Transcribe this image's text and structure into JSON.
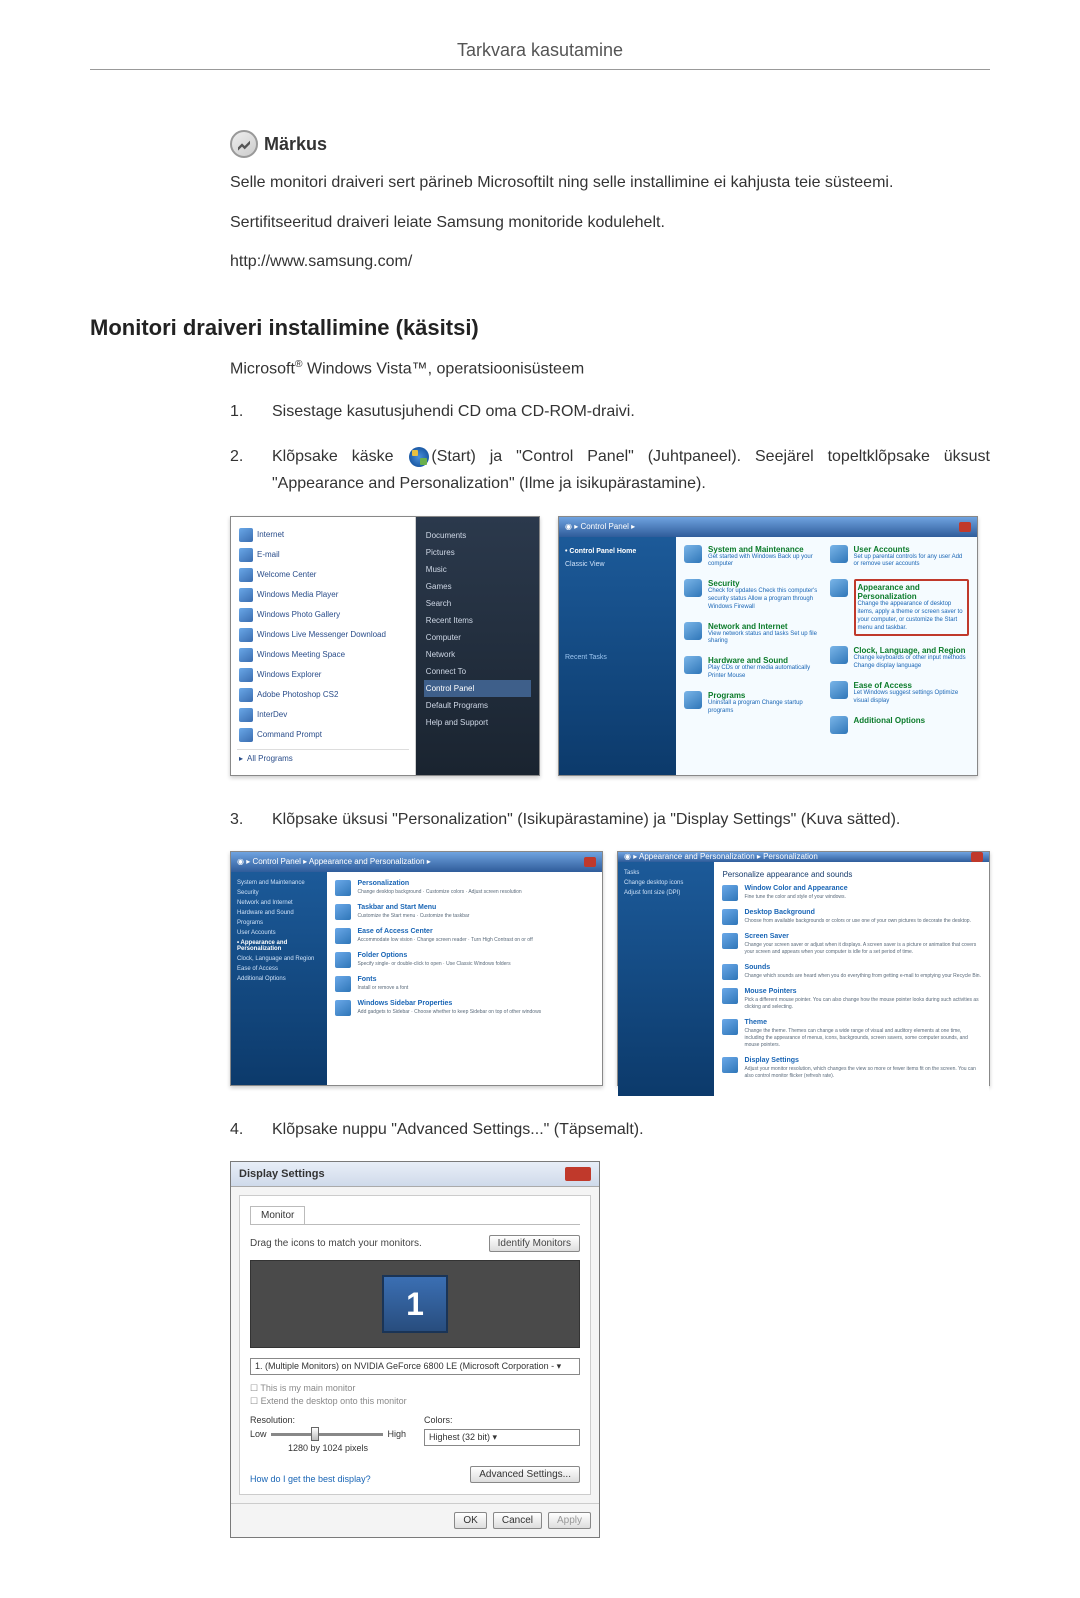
{
  "header": {
    "title": "Tarkvara kasutamine"
  },
  "note": {
    "label": "Märkus",
    "p1": "Selle monitori draiveri sert pärineb Microsoftilt ning selle installimine ei kahjusta teie süsteemi.",
    "p2": "Sertifitseeritud draiveri leiate Samsung monitoride kodulehelt.",
    "p3": "http://www.samsung.com/"
  },
  "section": {
    "title": "Monitori draiveri installimine (käsitsi)",
    "intro_prefix": "Microsoft",
    "intro_mid": " Windows Vista™",
    "intro_suffix": ", operatsioonisüsteem"
  },
  "steps": {
    "s1": {
      "num": "1.",
      "text": "Sisestage kasutusjuhendi CD oma CD-ROM-draivi."
    },
    "s2": {
      "num": "2.",
      "pre": "Klõpsake käske ",
      "post": "(Start) ja \"Control Panel\" (Juhtpaneel). Seejärel topeltklõpsake üksust \"Appearance and Personalization\" (Ilme ja isikupärastamine)."
    },
    "s3": {
      "num": "3.",
      "text": "Klõpsake üksusi \"Personalization\" (Isikupärastamine) ja \"Display Settings\" (Kuva sätted)."
    },
    "s4": {
      "num": "4.",
      "text": "Klõpsake nuppu \"Advanced Settings...\" (Täpsemalt)."
    }
  },
  "vista_start": {
    "items": [
      "Internet",
      "E-mail",
      "Welcome Center",
      "Windows Media Player",
      "Windows Photo Gallery",
      "Windows Live Messenger Download",
      "Windows Meeting Space",
      "Windows Explorer",
      "Adobe Photoshop CS2",
      "InterDev",
      "Command Prompt",
      "All Programs"
    ],
    "right": [
      "Documents",
      "Pictures",
      "Music",
      "Games",
      "Search",
      "Recent Items",
      "Computer",
      "Network",
      "Connect To",
      "Control Panel",
      "Default Programs",
      "Help and Support"
    ]
  },
  "control_panel": {
    "title": "Control Panel",
    "side": [
      "Control Panel Home",
      "Classic View"
    ],
    "recent": "Recent Tasks",
    "cats": {
      "system": {
        "t": "System and Maintenance",
        "s": "Get started with Windows\nBack up your computer"
      },
      "security": {
        "t": "Security",
        "s": "Check for updates\nCheck this computer's security status\nAllow a program through Windows Firewall"
      },
      "network": {
        "t": "Network and Internet",
        "s": "View network status and tasks\nSet up file sharing"
      },
      "hardware": {
        "t": "Hardware and Sound",
        "s": "Play CDs or other media automatically\nPrinter\nMouse"
      },
      "programs": {
        "t": "Programs",
        "s": "Uninstall a program\nChange startup programs"
      },
      "user": {
        "t": "User Accounts",
        "s": "Set up parental controls for any user\nAdd or remove user accounts"
      },
      "appearance": {
        "t": "Appearance and Personalization",
        "s": "Change the appearance of desktop items, apply a theme or screen saver to your computer, or customize the Start menu and taskbar."
      },
      "clock": {
        "t": "Clock, Language, and Region",
        "s": "Change keyboards or other input methods\nChange display language"
      },
      "ease": {
        "t": "Ease of Access",
        "s": "Let Windows suggest settings\nOptimize visual display"
      },
      "addl": {
        "t": "Additional Options"
      }
    }
  },
  "appearance_left": {
    "side": [
      "System and Maintenance",
      "Security",
      "Network and Internet",
      "Hardware and Sound",
      "Programs",
      "User Accounts",
      "Appearance and Personalization",
      "Clock, Language and Region",
      "Ease of Access",
      "Additional Options"
    ],
    "items": {
      "pers": {
        "t": "Personalization",
        "s": "Change desktop background · Customize colors · Adjust screen resolution"
      },
      "taskbar": {
        "t": "Taskbar and Start Menu",
        "s": "Customize the Start menu · Customize the taskbar"
      },
      "ease": {
        "t": "Ease of Access Center",
        "s": "Accommodate low vision · Change screen reader · Turn High Contrast on or off"
      },
      "folder": {
        "t": "Folder Options",
        "s": "Specify single- or double-click to open · Use Classic Windows folders"
      },
      "fonts": {
        "t": "Fonts",
        "s": "Install or remove a font"
      },
      "sidebar": {
        "t": "Windows Sidebar Properties",
        "s": "Add gadgets to Sidebar · Choose whether to keep Sidebar on top of other windows"
      }
    }
  },
  "personalization": {
    "heading": "Personalize appearance and sounds",
    "items": {
      "color": {
        "t": "Window Color and Appearance",
        "s": "Fine tune the color and style of your windows."
      },
      "bg": {
        "t": "Desktop Background",
        "s": "Choose from available backgrounds or colors or use one of your own pictures to decorate the desktop."
      },
      "ss": {
        "t": "Screen Saver",
        "s": "Change your screen saver or adjust when it displays. A screen saver is a picture or animation that covers your screen and appears when your computer is idle for a set period of time."
      },
      "sounds": {
        "t": "Sounds",
        "s": "Change which sounds are heard when you do everything from getting e-mail to emptying your Recycle Bin."
      },
      "mouse": {
        "t": "Mouse Pointers",
        "s": "Pick a different mouse pointer. You can also change how the mouse pointer looks during such activities as clicking and selecting."
      },
      "theme": {
        "t": "Theme",
        "s": "Change the theme. Themes can change a wide range of visual and auditory elements at one time, including the appearance of menus, icons, backgrounds, screen savers, some computer sounds, and mouse pointers."
      },
      "display": {
        "t": "Display Settings",
        "s": "Adjust your monitor resolution, which changes the view so more or fewer items fit on the screen. You can also control monitor flicker (refresh rate)."
      }
    }
  },
  "display_settings": {
    "title": "Display Settings",
    "tab": "Monitor",
    "drag": "Drag the icons to match your monitors.",
    "identify": "Identify Monitors",
    "monitor_num": "1",
    "dropdown": "1. (Multiple Monitors) on NVIDIA GeForce 6800 LE (Microsoft Corporation - ▾",
    "chk1": "This is my main monitor",
    "chk2": "Extend the desktop onto this monitor",
    "res_label": "Resolution:",
    "low": "Low",
    "high": "High",
    "res_val": "1280 by 1024 pixels",
    "color_label": "Colors:",
    "color_val": "Highest (32 bit)",
    "link": "How do I get the best display?",
    "adv": "Advanced Settings...",
    "ok": "OK",
    "cancel": "Cancel",
    "apply": "Apply"
  }
}
